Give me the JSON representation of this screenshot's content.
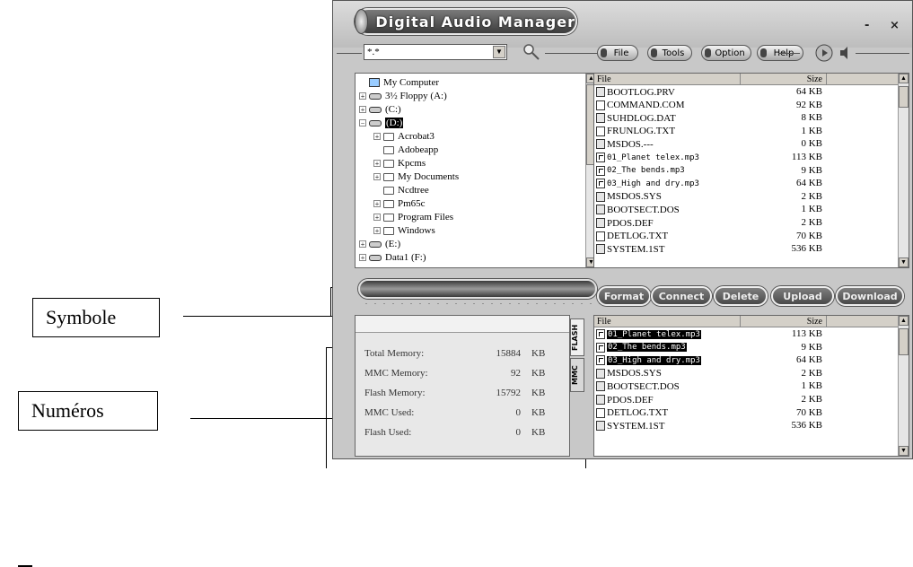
{
  "app": {
    "title": "Digital Audio Manager",
    "minimize": "-",
    "close": "×"
  },
  "toolbar": {
    "filter_value": "*.*",
    "menus": [
      "File",
      "Tools",
      "Option",
      "Help"
    ]
  },
  "tree": [
    {
      "label": "My Computer",
      "type": "computer",
      "level": 0
    },
    {
      "label": "3½ Floppy (A:)",
      "type": "floppy",
      "level": 0,
      "expander": "+"
    },
    {
      "label": "(C:)",
      "type": "drive",
      "level": 0,
      "expander": "+"
    },
    {
      "label": "(D:)",
      "type": "drive",
      "level": 0,
      "expander": "−",
      "selected": true
    },
    {
      "label": "Acrobat3",
      "type": "folder",
      "level": 1,
      "expander": "+"
    },
    {
      "label": "Adobeapp",
      "type": "folder",
      "level": 1
    },
    {
      "label": "Kpcms",
      "type": "folder",
      "level": 1,
      "expander": "+"
    },
    {
      "label": "My Documents",
      "type": "folder",
      "level": 1,
      "expander": "+"
    },
    {
      "label": "Ncdtree",
      "type": "folder",
      "level": 1
    },
    {
      "label": "Pm65c",
      "type": "folder",
      "level": 1,
      "expander": "+"
    },
    {
      "label": "Program Files",
      "type": "folder",
      "level": 1,
      "expander": "+"
    },
    {
      "label": "Windows",
      "type": "folder",
      "level": 1,
      "expander": "+"
    },
    {
      "label": "(E:)",
      "type": "drive",
      "level": 0,
      "expander": "+"
    },
    {
      "label": "Data1 (F:)",
      "type": "drive",
      "level": 0,
      "expander": "+"
    }
  ],
  "pc_files": {
    "columns": [
      "File",
      "Size"
    ],
    "rows": [
      {
        "name": "BOOTLOG.PRV",
        "size": "64 KB",
        "icon": "sys"
      },
      {
        "name": "COMMAND.COM",
        "size": "92 KB",
        "icon": "blank"
      },
      {
        "name": "SUHDLOG.DAT",
        "size": "8 KB",
        "icon": "sys"
      },
      {
        "name": "FRUNLOG.TXT",
        "size": "1 KB",
        "icon": "txt"
      },
      {
        "name": "MSDOS.---",
        "size": "0 KB",
        "icon": "sys"
      },
      {
        "name": "01_Planet telex.mp3",
        "size": "113 KB",
        "icon": "mp3",
        "mono": true
      },
      {
        "name": "02_The bends.mp3",
        "size": "9 KB",
        "icon": "mp3",
        "mono": true
      },
      {
        "name": "03_High and dry.mp3",
        "size": "64 KB",
        "icon": "mp3",
        "mono": true
      },
      {
        "name": "MSDOS.SYS",
        "size": "2 KB",
        "icon": "sys"
      },
      {
        "name": "BOOTSECT.DOS",
        "size": "1 KB",
        "icon": "sys"
      },
      {
        "name": "PDOS.DEF",
        "size": "2 KB",
        "icon": "sys"
      },
      {
        "name": "DETLOG.TXT",
        "size": "70 KB",
        "icon": "txt"
      },
      {
        "name": "SYSTEM.1ST",
        "size": "536 KB",
        "icon": "sys"
      }
    ]
  },
  "actions": [
    "Format",
    "Connect",
    "Delete",
    "Upload",
    "Download"
  ],
  "memory": [
    {
      "label": "Total Memory:",
      "value": "15884",
      "unit": "KB"
    },
    {
      "label": "MMC Memory:",
      "value": "92",
      "unit": "KB"
    },
    {
      "label": "Flash Memory:",
      "value": "15792",
      "unit": "KB"
    },
    {
      "label": "MMC Used:",
      "value": "0",
      "unit": "KB"
    },
    {
      "label": "Flash Used:",
      "value": "0",
      "unit": "KB"
    }
  ],
  "device_tabs": [
    "FLASH",
    "MMC"
  ],
  "device_files": {
    "columns": [
      "File",
      "Size"
    ],
    "rows": [
      {
        "name": "01_Planet telex.mp3",
        "size": "113 KB",
        "icon": "mp3",
        "mono": true,
        "selected": true
      },
      {
        "name": "02_The bends.mp3",
        "size": "9 KB",
        "icon": "mp3",
        "mono": true,
        "selected": true
      },
      {
        "name": "03_High and dry.mp3",
        "size": "64 KB",
        "icon": "mp3",
        "mono": true,
        "selected": true
      },
      {
        "name": "MSDOS.SYS",
        "size": "2 KB",
        "icon": "sys"
      },
      {
        "name": "BOOTSECT.DOS",
        "size": "1 KB",
        "icon": "sys"
      },
      {
        "name": "PDOS.DEF",
        "size": "2 KB",
        "icon": "sys"
      },
      {
        "name": "DETLOG.TXT",
        "size": "70 KB",
        "icon": "txt"
      },
      {
        "name": "SYSTEM.1ST",
        "size": "536 KB",
        "icon": "sys"
      }
    ]
  },
  "callouts": {
    "symbole": "Symbole",
    "numeros": "Numéros"
  }
}
